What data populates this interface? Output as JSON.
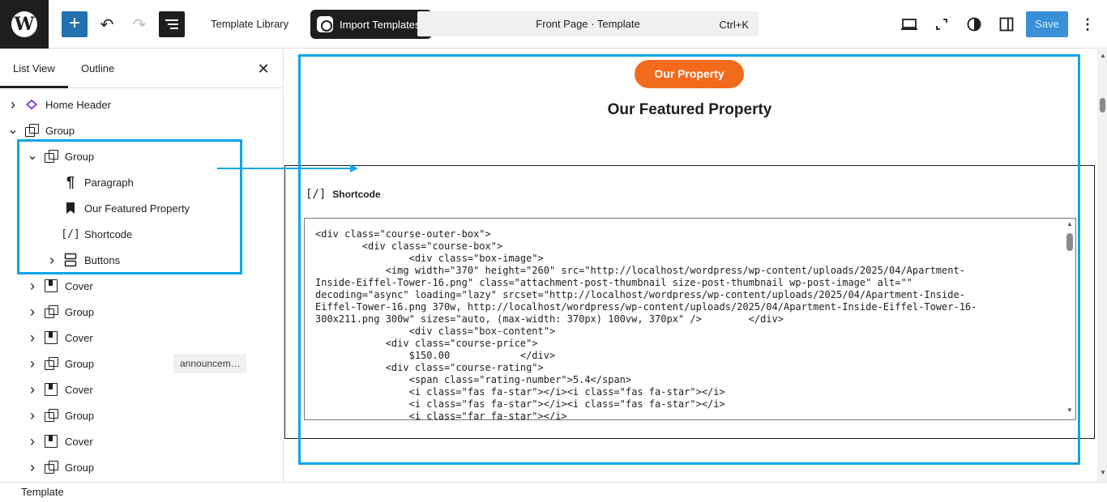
{
  "topbar": {
    "template_library": "Template Library",
    "import_templates": "Import Templates",
    "command_title": "Front Page · Template",
    "command_shortcut": "Ctrl+K",
    "save": "Save"
  },
  "sidebar": {
    "tabs": [
      "List View",
      "Outline"
    ],
    "items": [
      {
        "label": "Home Header",
        "icon": "template-part-icon",
        "depth": 0,
        "chevron": "right"
      },
      {
        "label": "Group",
        "icon": "group-icon",
        "depth": 0,
        "chevron": "down"
      },
      {
        "label": "Group",
        "icon": "group-icon",
        "depth": 1,
        "chevron": "down"
      },
      {
        "label": "Paragraph",
        "icon": "paragraph-icon",
        "depth": 2,
        "chevron": ""
      },
      {
        "label": "Our Featured Property",
        "icon": "heading-bookmark-icon",
        "depth": 2,
        "chevron": ""
      },
      {
        "label": "Shortcode",
        "icon": "shortcode-icon",
        "depth": 2,
        "chevron": ""
      },
      {
        "label": "Buttons",
        "icon": "buttons-icon",
        "depth": 2,
        "chevron": "right"
      },
      {
        "label": "Cover",
        "icon": "cover-icon",
        "depth": 1,
        "chevron": "right"
      },
      {
        "label": "Group",
        "icon": "group-icon",
        "depth": 1,
        "chevron": "right"
      },
      {
        "label": "Cover",
        "icon": "cover-icon",
        "depth": 1,
        "chevron": "right"
      },
      {
        "label": "Group",
        "icon": "group-icon",
        "depth": 1,
        "chevron": "right"
      },
      {
        "label": "Cover",
        "icon": "cover-icon",
        "depth": 1,
        "chevron": "right"
      },
      {
        "label": "Group",
        "icon": "group-icon",
        "depth": 1,
        "chevron": "right"
      },
      {
        "label": "Cover",
        "icon": "cover-icon",
        "depth": 1,
        "chevron": "right"
      },
      {
        "label": "Group",
        "icon": "group-icon",
        "depth": 1,
        "chevron": "right"
      }
    ],
    "anchor_badge": "announcem…"
  },
  "canvas": {
    "pill_button": "Our Property",
    "heading": "Our Featured Property",
    "shortcode_label": "Shortcode",
    "shortcode_glyph": "[/]",
    "code_lines": [
      "<div class=\"course-outer-box\">",
      "        <div class=\"course-box\">",
      "                <div class=\"box-image\">",
      "            <img width=\"370\" height=\"260\" src=\"http://localhost/wordpress/wp-content/uploads/2025/04/Apartment-",
      "Inside-Eiffel-Tower-16.png\" class=\"attachment-post-thumbnail size-post-thumbnail wp-post-image\" alt=\"\"",
      "decoding=\"async\" loading=\"lazy\" srcset=\"http://localhost/wordpress/wp-content/uploads/2025/04/Apartment-Inside-",
      "Eiffel-Tower-16.png 370w, http://localhost/wordpress/wp-content/uploads/2025/04/Apartment-Inside-Eiffel-Tower-16-",
      "300x211.png 300w\" sizes=\"auto, (max-width: 370px) 100vw, 370px\" />        </div>",
      "                <div class=\"box-content\">",
      "            <div class=\"course-price\">",
      "                $150.00            </div>",
      "            <div class=\"course-rating\">",
      "                <span class=\"rating-number\">5.4</span>",
      "                <i class=\"fas fa-star\"></i><i class=\"fas fa-star\"></i>",
      "                <i class=\"fas fa-star\"></i><i class=\"fas fa-star\"></i>",
      "                <i class=\"far fa-star\"></i>"
    ]
  },
  "status_bar": {
    "breadcrumb": "Template"
  },
  "colors": {
    "accent": "#2271b1",
    "highlight": "#0ea5e9",
    "pill": "#f26b1d"
  }
}
